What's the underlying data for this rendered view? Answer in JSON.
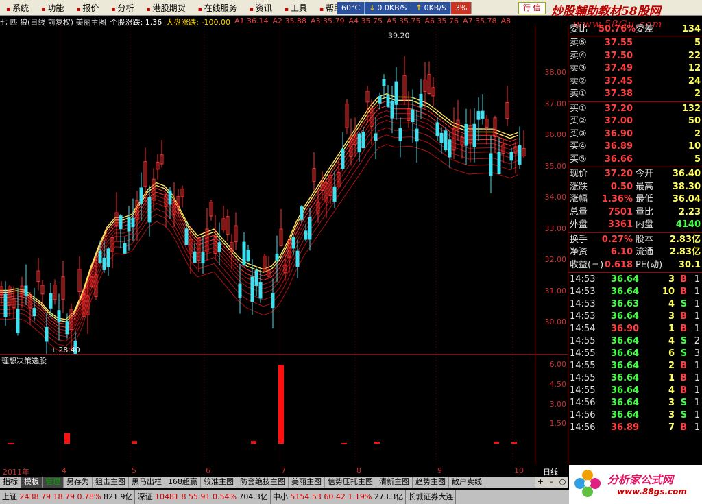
{
  "menu": [
    "系统",
    "功能",
    "报价",
    "分析",
    "港股期货",
    "在线服务",
    "资讯",
    "工具",
    "帮助"
  ],
  "status": {
    "temp": "60°C",
    "down_speed": "0.0KB/S",
    "up_speed": "0KB/S",
    "pct": "3%"
  },
  "trade_button": "行 信",
  "watermark": {
    "line1": "炒股輔助教材58股网",
    "line2": "www.58Gu.com"
  },
  "titlebar": {
    "name": "七 匹 狼(日线 前复权) 美丽主图",
    "stock_change_label": "个股涨跌: 1.36",
    "market_change_label": "大盘涨跌: -100.00",
    "ma_values": [
      "A1 36.14",
      "A2 35.88",
      "A3 35.79",
      "A4 35.75",
      "A5 35.75",
      "A6 35.76",
      "A7 35.78",
      "A8"
    ]
  },
  "chart_data": [
    {
      "type": "line",
      "title": "",
      "x_labels": [
        "4",
        "5",
        "6",
        "7",
        "8",
        "9",
        "10"
      ],
      "ylim": [
        29.0,
        39.5
      ],
      "y_ticks": [
        "38.00",
        "37.00",
        "36.00",
        "35.00",
        "34.00",
        "33.00",
        "32.00",
        "31.00",
        "30.00"
      ],
      "annotations": [
        "←28.40",
        "39.20"
      ],
      "x": [
        0,
        12,
        24,
        36,
        48,
        60,
        72,
        84,
        96,
        108,
        120,
        132,
        144,
        156,
        168,
        180,
        192,
        204,
        216,
        228,
        240,
        252,
        264,
        276,
        288,
        300,
        312,
        324,
        336,
        348,
        360,
        372,
        384,
        396,
        408,
        420,
        432,
        444,
        456,
        468,
        480,
        492,
        504,
        516,
        528,
        540,
        552,
        564,
        576,
        588,
        600,
        612,
        624,
        636,
        648,
        660,
        672,
        684,
        696,
        708,
        720,
        732,
        744,
        756
      ],
      "series": [
        {
          "values": [
            30.9,
            30.9,
            30.95,
            30.9,
            30.7,
            30.5,
            30.2,
            30.0,
            29.95,
            30.2,
            30.8,
            31.6,
            32.3,
            32.9,
            33.2,
            33.2,
            33.3,
            33.7,
            34.1,
            34.3,
            34.2,
            33.9,
            33.4,
            32.9,
            32.6,
            32.7,
            32.8,
            32.5,
            32.2,
            31.9,
            31.7,
            31.6,
            31.5,
            31.6,
            31.9,
            32.4,
            33.0,
            33.5,
            33.9,
            34.3,
            34.7,
            35.1,
            35.5,
            35.9,
            36.3,
            36.7,
            37.0,
            37.1,
            37.0,
            37.0,
            37.0,
            36.9,
            36.8,
            36.6,
            36.4,
            36.2,
            36.1,
            36.0,
            36.0,
            36.0,
            36.0,
            35.9,
            35.8,
            35.9
          ]
        }
      ]
    },
    {
      "type": "bar",
      "title": "理想决策选股",
      "ylim": [
        0,
        6.8
      ],
      "y_ticks": [
        "6.00",
        "4.50",
        "3.00",
        "1.50"
      ],
      "x": [
        16,
        98,
        196,
        370,
        410,
        502,
        550,
        724,
        750
      ],
      "values": [
        0.05,
        0.8,
        0.2,
        0.2,
        6.0,
        0.05,
        0.15,
        0.15,
        0.15
      ]
    }
  ],
  "sidebar": {
    "top_row": {
      "label": "委比",
      "value": "50.76%",
      "label2": "委差",
      "value2": "134"
    },
    "asks": [
      {
        "label": "卖⑤",
        "price": "37.55",
        "vol": "5"
      },
      {
        "label": "卖④",
        "price": "37.50",
        "vol": "22"
      },
      {
        "label": "卖③",
        "price": "37.49",
        "vol": "12"
      },
      {
        "label": "卖②",
        "price": "37.45",
        "vol": "24"
      },
      {
        "label": "卖①",
        "price": "37.38",
        "vol": "2"
      }
    ],
    "bids": [
      {
        "label": "买①",
        "price": "37.20",
        "vol": "132"
      },
      {
        "label": "买②",
        "price": "37.00",
        "vol": "50"
      },
      {
        "label": "买③",
        "price": "36.90",
        "vol": "2"
      },
      {
        "label": "买④",
        "price": "36.89",
        "vol": "10"
      },
      {
        "label": "买⑤",
        "price": "36.66",
        "vol": "5"
      }
    ],
    "stats": [
      {
        "l1": "现价",
        "v1": "37.20",
        "l2": "今开",
        "v2": "36.40"
      },
      {
        "l1": "涨跌",
        "v1": "0.50",
        "l2": "最高",
        "v2": "38.30"
      },
      {
        "l1": "涨幅",
        "v1": "1.36%",
        "l2": "最低",
        "v2": "36.04"
      },
      {
        "l1": "总量",
        "v1": "7501",
        "l2": "量比",
        "v2": "2.23"
      },
      {
        "l1": "外盘",
        "v1": "3361",
        "l2": "内盘",
        "v2": "4140"
      }
    ],
    "stats2": [
      {
        "l1": "换手",
        "v1": "0.27%",
        "l2": "股本",
        "v2": "2.83亿"
      },
      {
        "l1": "净资",
        "v1": "6.10",
        "l2": "流通",
        "v2": "2.83亿"
      },
      {
        "l1": "收益(三)",
        "v1": "0.618",
        "l2": "PE(动)",
        "v2": "30.1"
      }
    ],
    "ticks": [
      {
        "time": "14:53",
        "price": "36.64",
        "vol": "3",
        "side": "B",
        "cnt": "1"
      },
      {
        "time": "14:53",
        "price": "36.64",
        "vol": "10",
        "side": "B",
        "cnt": "1"
      },
      {
        "time": "14:53",
        "price": "36.63",
        "vol": "4",
        "side": "S",
        "cnt": "1"
      },
      {
        "time": "14:53",
        "price": "36.64",
        "vol": "3",
        "side": "B",
        "cnt": "1"
      },
      {
        "time": "14:54",
        "price": "36.90",
        "vol": "1",
        "side": "B",
        "cnt": "1"
      },
      {
        "time": "14:55",
        "price": "36.64",
        "vol": "4",
        "side": "S",
        "cnt": "2"
      },
      {
        "time": "14:55",
        "price": "36.64",
        "vol": "6",
        "side": "S",
        "cnt": "3"
      },
      {
        "time": "14:55",
        "price": "36.64",
        "vol": "2",
        "side": "B",
        "cnt": "1"
      },
      {
        "time": "14:55",
        "price": "36.64",
        "vol": "1",
        "side": "B",
        "cnt": "1"
      },
      {
        "time": "14:55",
        "price": "36.64",
        "vol": "4",
        "side": "B",
        "cnt": "1"
      },
      {
        "time": "14:56",
        "price": "36.64",
        "vol": "3",
        "side": "S",
        "cnt": "1"
      },
      {
        "time": "14:56",
        "price": "36.64",
        "vol": "3",
        "side": "S",
        "cnt": "1"
      },
      {
        "time": "14:56",
        "price": "36.89",
        "vol": "7",
        "side": "B",
        "cnt": "1"
      }
    ]
  },
  "date_axis": {
    "year": "2011年",
    "period": "日线"
  },
  "tabs": [
    "指标",
    "模板",
    "管理",
    "另存为",
    "狙击主图",
    "黑马出栏",
    "168超赢",
    "较准主图",
    "防套绝技主图",
    "美丽主图",
    "信势压托主图",
    "清新主图",
    "趋势主图",
    "散户卖线"
  ],
  "scroll": [
    "+",
    "-",
    "○"
  ],
  "indices": [
    {
      "name": "上证",
      "v": "2438.79",
      "chg": "18.79",
      "pct": "0.78%",
      "amt": "821.9亿"
    },
    {
      "name": "深证",
      "v": "10481.8",
      "chg": "55.91",
      "pct": "0.54%",
      "amt": "704.3亿"
    },
    {
      "name": "中小",
      "v": "5154.53",
      "chg": "60.42",
      "pct": "1.19%",
      "amt": "273.3亿"
    }
  ],
  "broker": "长城证券大连",
  "logo": {
    "line1": "分析家公式网",
    "line2": "www.88gs.com"
  }
}
